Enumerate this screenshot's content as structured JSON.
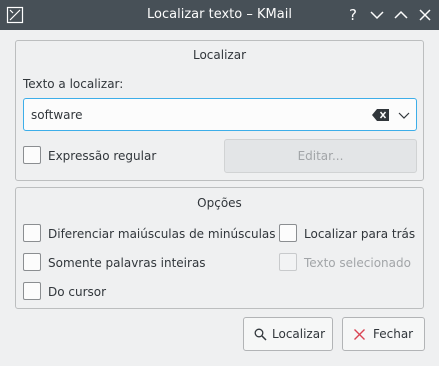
{
  "window": {
    "title": "Localizar texto – KMail",
    "title_bar_color": "#475057",
    "app_icon": "kde-app-icon",
    "controls": [
      "help-icon",
      "minimize-icon",
      "maximize-icon",
      "close-icon"
    ],
    "help_glyph": "?"
  },
  "find_group": {
    "title": "Localizar",
    "search_label": "Texto a localizar:",
    "search_value": "software",
    "regex_label": "Expressão regular",
    "regex_checked": false,
    "edit_button": "Editar...",
    "edit_enabled": false
  },
  "options_group": {
    "title": "Opções",
    "case_sensitive": "Diferenciar maiúsculas de minúsculas",
    "find_backwards": "Localizar para trás",
    "whole_words": "Somente palavras inteiras",
    "selected_text": "Texto selecionado",
    "selected_text_enabled": false,
    "from_cursor": "Do cursor"
  },
  "buttons": {
    "find": "Localizar",
    "close": "Fechar"
  },
  "colors": {
    "focus_accent": "#3daee9",
    "close_icon_red": "#da4453"
  }
}
